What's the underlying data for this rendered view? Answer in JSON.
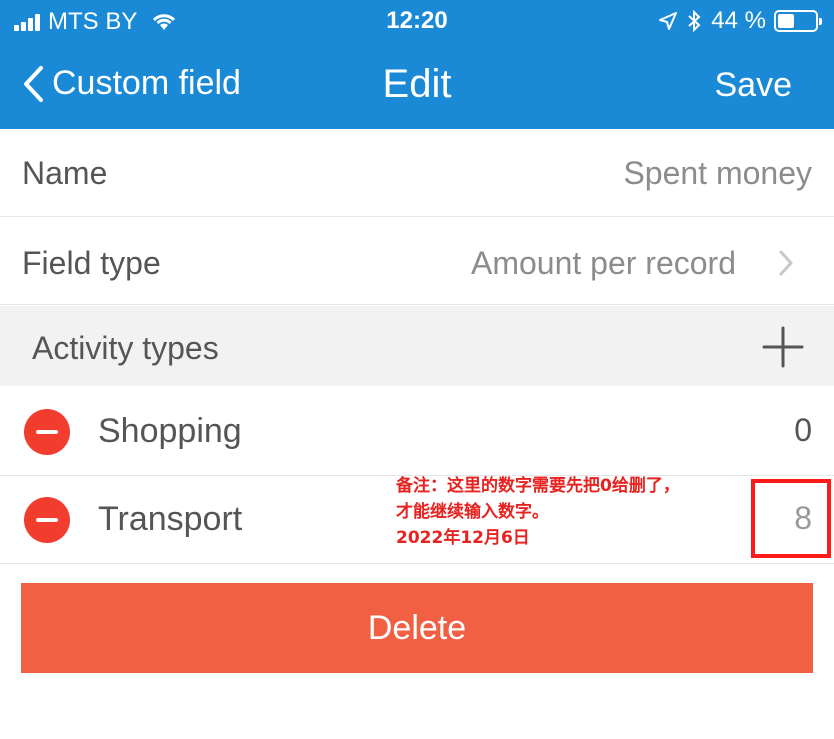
{
  "status_bar": {
    "carrier": "MTS BY",
    "time": "12:20",
    "battery": "44 %",
    "battery_level": 0.44,
    "icons": [
      "signal-icon",
      "wifi-icon",
      "location-icon",
      "bluetooth-icon",
      "battery-icon"
    ]
  },
  "nav": {
    "back_label": "Custom field",
    "title": "Edit",
    "save_label": "Save"
  },
  "form": {
    "name_label": "Name",
    "name_value": "Spent money",
    "type_label": "Field type",
    "type_value": "Amount per record"
  },
  "activity_section": {
    "title": "Activity types",
    "items": [
      {
        "name": "Shopping",
        "value": "0"
      },
      {
        "name": "Transport",
        "value": "8"
      }
    ]
  },
  "annotation": {
    "lines": [
      "备注：这里的数字需要先把0给删了，",
      "才能继续输入数字。",
      "2022年12月6日"
    ],
    "color": "#e8221f"
  },
  "delete_label": "Delete",
  "colors": {
    "header": "#1a8ad6",
    "delete_button": "#f26044",
    "remove_icon": "#f23c2d"
  }
}
